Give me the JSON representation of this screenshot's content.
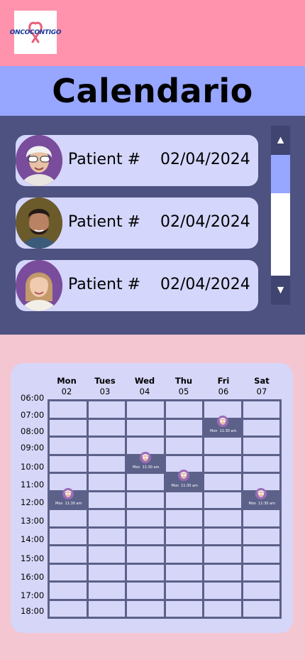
{
  "header": {
    "logo_text": "ONCOCONTIGO"
  },
  "title": "Calendario",
  "patients": [
    {
      "name": "Patient #",
      "date": "02/04/2024",
      "avatar": "elderly-woman-sunglasses"
    },
    {
      "name": "Patient #",
      "date": "02/04/2024",
      "avatar": "young-man-beard"
    },
    {
      "name": "Patient #",
      "date": "02/04/2024",
      "avatar": "young-woman-blonde"
    }
  ],
  "scrollbar": {
    "up_icon": "▲",
    "down_icon": "▼"
  },
  "calendar": {
    "days": [
      {
        "name": "Mon",
        "num": "02"
      },
      {
        "name": "Tues",
        "num": "03"
      },
      {
        "name": "Wed",
        "num": "04"
      },
      {
        "name": "Thu",
        "num": "05"
      },
      {
        "name": "Fri",
        "num": "06"
      },
      {
        "name": "Sat",
        "num": "07"
      }
    ],
    "times": [
      "06:00",
      "07:00",
      "08:00",
      "09:00",
      "10:00",
      "11:00",
      "12:00",
      "13:00",
      "14:00",
      "15:00",
      "16:00",
      "17:00",
      "18:00"
    ],
    "appointments": [
      {
        "col": 4,
        "row": 1,
        "day": "Mon",
        "time": "11:30 am"
      },
      {
        "col": 2,
        "row": 3,
        "day": "Mon",
        "time": "11:30 am"
      },
      {
        "col": 3,
        "row": 4,
        "day": "Mon",
        "time": "11:30 am"
      },
      {
        "col": 0,
        "row": 5,
        "day": "Mon",
        "time": "11:30 am"
      },
      {
        "col": 5,
        "row": 5,
        "day": "Mon",
        "time": "11:30 am"
      }
    ]
  },
  "colors": {
    "header_pink": "#ff93ad",
    "title_blue": "#97a6ff",
    "panel_navy": "#4d5280",
    "card_lavender": "#d4d6fb"
  }
}
